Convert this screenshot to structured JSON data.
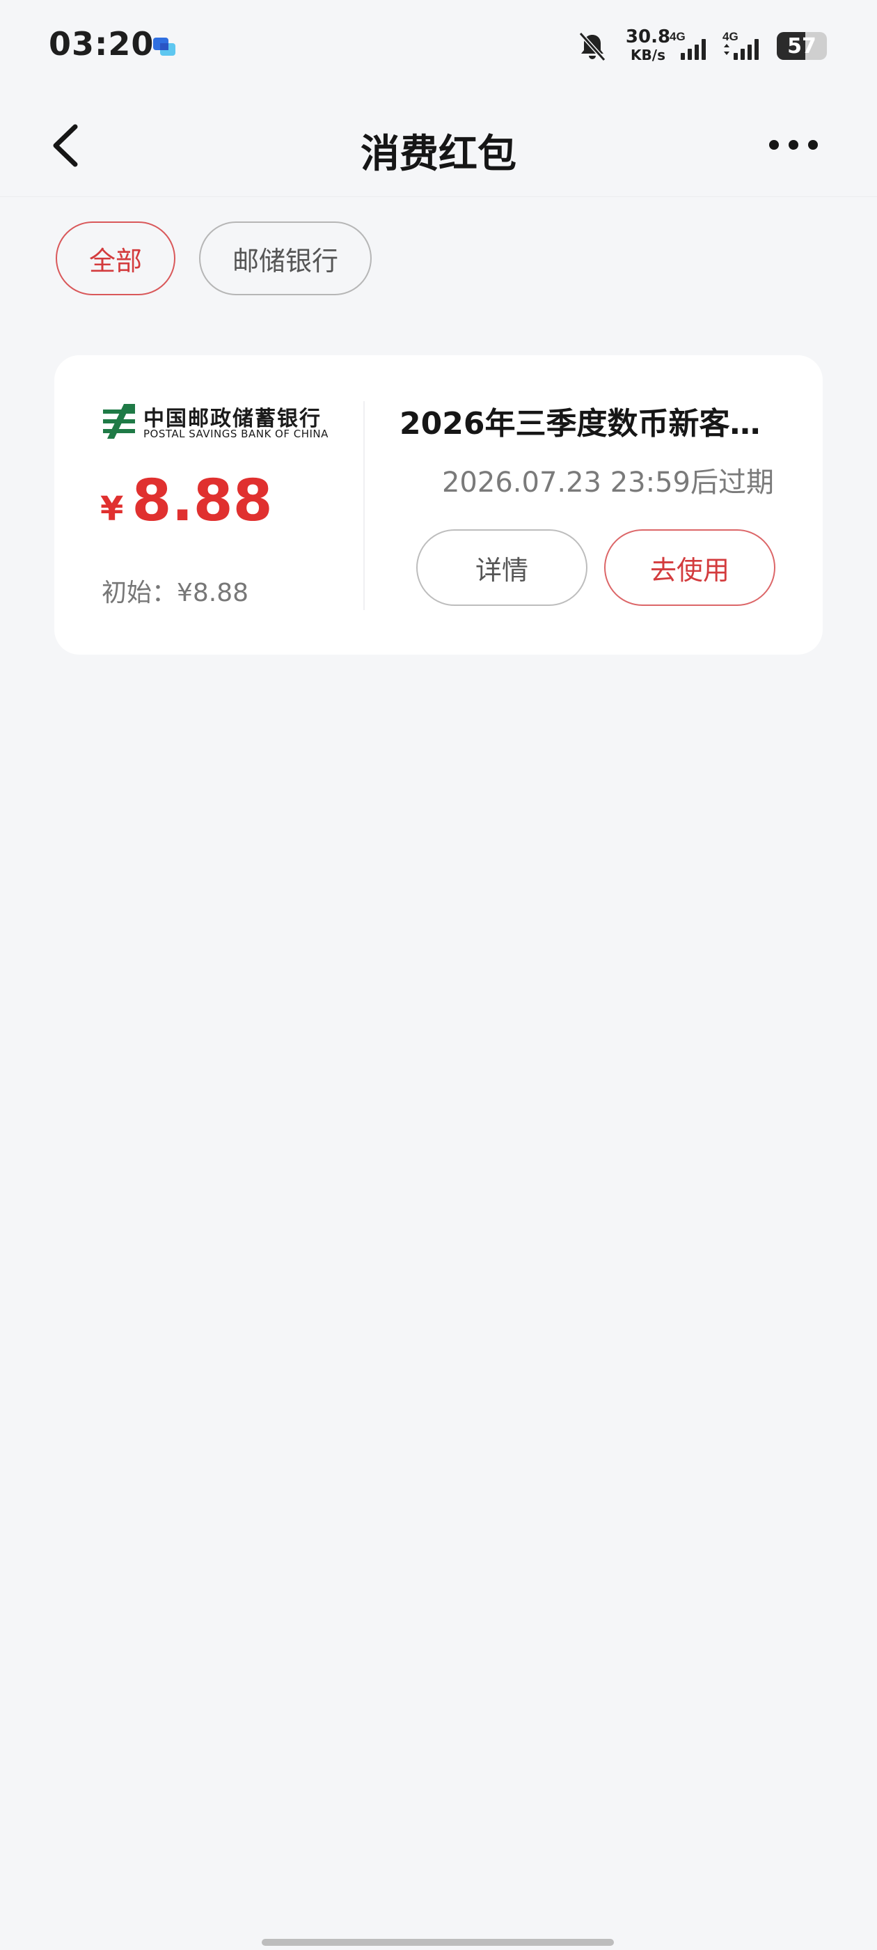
{
  "status_bar": {
    "time": "03:20",
    "net_speed_value": "30.8",
    "net_speed_unit": "KB/s",
    "sim1_type": "4G",
    "sim2_type": "4G",
    "battery_level": "57",
    "battery_fraction": 0.57,
    "icons": [
      "message-app-icon",
      "bell-off-icon",
      "signal-icon",
      "battery-icon"
    ]
  },
  "header": {
    "title": "消费红包",
    "icons": [
      "back-icon",
      "more-icon"
    ]
  },
  "filters": {
    "items": [
      {
        "label": "全部",
        "selected": true
      },
      {
        "label": "邮储银行",
        "selected": false
      }
    ]
  },
  "coupon": {
    "bank_name_cn": "中国邮政储蓄银行",
    "bank_name_en": "POSTAL SAVINGS BANK OF CHINA",
    "currency_symbol": "¥",
    "amount": "8.88",
    "initial_label": "初始：¥8.88",
    "title": "2026年三季度数币新客…",
    "expire_text": "2026.07.23 23:59后过期",
    "detail_button": "详情",
    "use_button": "去使用"
  },
  "colors": {
    "accent_red": "#e0302f",
    "background": "#f5f6f8",
    "bank_green": "#1f7a46"
  }
}
